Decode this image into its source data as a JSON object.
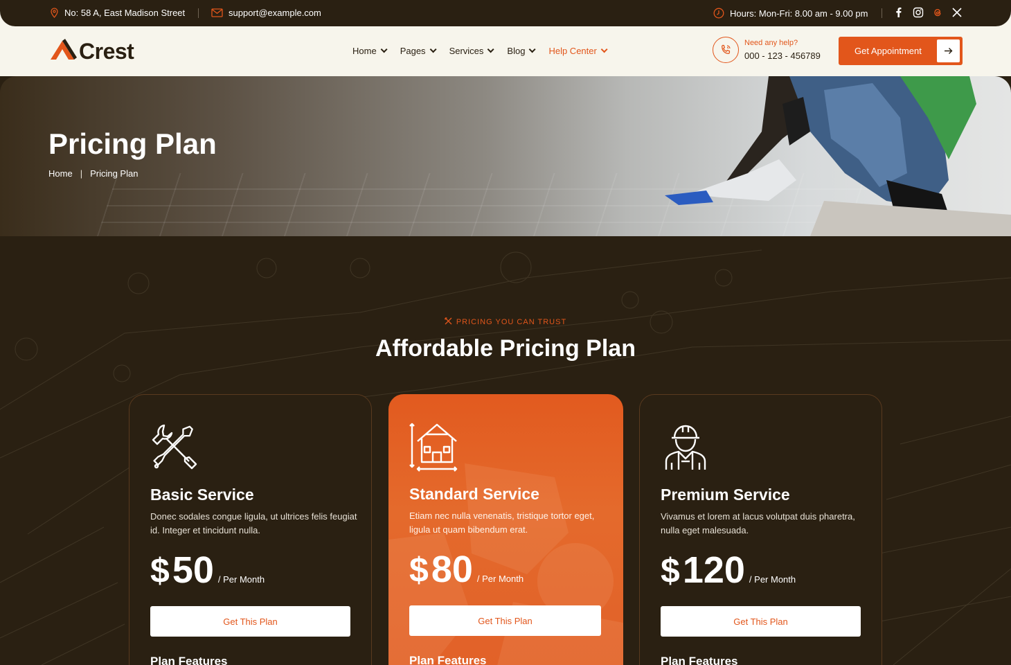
{
  "topbar": {
    "address": "No: 58 A, East Madison Street",
    "email": "support@example.com",
    "hours": "Hours: Mon-Fri: 8.00 am - 9.00 pm",
    "social": [
      "facebook-icon",
      "instagram-icon",
      "threads-icon",
      "x-icon"
    ]
  },
  "header": {
    "logo": "Crest",
    "nav": [
      {
        "label": "Home"
      },
      {
        "label": "Pages"
      },
      {
        "label": "Services"
      },
      {
        "label": "Blog"
      },
      {
        "label": "Help Center",
        "active": true
      }
    ],
    "help_label": "Need any help?",
    "help_phone": "000 - 123 - 456789",
    "cta": "Get Appointment"
  },
  "hero": {
    "title": "Pricing Plan",
    "breadcrumb": [
      "Home",
      "Pricing Plan"
    ]
  },
  "section": {
    "tag": "PRICING YOU CAN TRUST",
    "title": "Affordable Pricing Plan"
  },
  "plans": [
    {
      "icon": "tools-icon",
      "name": "Basic Service",
      "desc": "Donec sodales congue ligula, ut ultrices felis feugiat id. Integer et tincidunt nulla.",
      "currency": "$",
      "price": "50",
      "period": "/ Per Month",
      "button": "Get This Plan",
      "features_heading": "Plan Features"
    },
    {
      "icon": "house-plan-icon",
      "name": "Standard Service",
      "desc": "Etiam nec nulla venenatis, tristique tortor eget, ligula ut quam bibendum erat.",
      "currency": "$",
      "price": "80",
      "period": "/ Per Month",
      "button": "Get This Plan",
      "features_heading": "Plan Features"
    },
    {
      "icon": "worker-icon",
      "name": "Premium Service",
      "desc": "Vivamus et lorem at lacus volutpat duis pharetra, nulla eget malesuada.",
      "currency": "$",
      "price": "120",
      "period": "/ Per Month",
      "button": "Get This Plan",
      "features_heading": "Plan Features"
    }
  ],
  "colors": {
    "accent": "#e2561b",
    "dark": "#2a2012",
    "header_bg": "#f7f5ec"
  }
}
